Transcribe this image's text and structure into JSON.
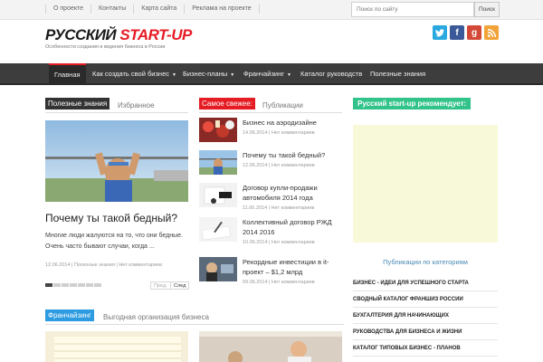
{
  "top_nav": {
    "items": [
      "О проекте",
      "Контакты",
      "Карта сайта",
      "Реклама на проекте"
    ]
  },
  "search": {
    "placeholder": "Поиск по сайту",
    "button_label": "Поиск"
  },
  "logo": {
    "part1": "РУССКИЙ ",
    "part2": "START-UP",
    "tagline": "Особенности создания и ведения бизнеса в России"
  },
  "social": {
    "twitter": "t",
    "facebook": "f",
    "google": "g",
    "rss": "rss"
  },
  "main_nav": {
    "items": [
      {
        "label": "Главная"
      },
      {
        "label": "Как создать свой бизнес"
      },
      {
        "label": "Бизнес-планы"
      },
      {
        "label": "Франчайзинг"
      },
      {
        "label": "Каталог руководств"
      },
      {
        "label": "Полезные знания"
      }
    ]
  },
  "featured": {
    "label": "Полезные знания",
    "sublabel": "Избранное",
    "title": "Почему ты такой бедный?",
    "text": "Многие люди жалуются на то, что они бедные. Очень часто бывают случаи, когда ...",
    "meta": "12.06.2014 | Полезные знания | Нет комментариев",
    "prev_label": "Пред.",
    "next_label": "След"
  },
  "publications": {
    "label": "Самое свежее:",
    "sublabel": "Публикации",
    "items": [
      {
        "title": "Бизнес на аэродизайне",
        "date": "14.06.2014 | Нет комментариев"
      },
      {
        "title": "Почему ты такой бедный?",
        "date": "12.06.2014 | Нет комментариев"
      },
      {
        "title": "Договор купли-продажи автомобиля 2014 года",
        "date": "11.06.2014 | Нет комментариев"
      },
      {
        "title": "Коллективный договор РЖД 2014 2016",
        "date": "10.06.2014 | Нет комментариев"
      },
      {
        "title": "Рекордные инвестиции в it-проект – $1,2 млрд",
        "date": "09.06.2014 | Нет комментариев"
      }
    ]
  },
  "recommend": {
    "label": "Русский start-up рекомендует:"
  },
  "categories": {
    "heading": "Публикации по категориям",
    "items": [
      "БИЗНЕС - ИДЕИ ДЛЯ УСПЕШНОГО СТАРТА",
      "СВОДНЫЙ КАТАЛОГ ФРАНШИЗ РОССИИ",
      "БУХГАЛТЕРИЯ ДЛЯ НАЧИНАЮЩИХ",
      "РУКОВОДСТВА ДЛЯ БИЗНЕСА И ЖИЗНИ",
      "КАТАЛОГ ТИПОВЫХ БИЗНЕС - ПЛАНОВ"
    ]
  },
  "franchising": {
    "label": "Франчайзинг",
    "sublabel": "Выгодная организация бизнеса"
  },
  "colors": {
    "accent_red": "#e61c24",
    "label_dark": "#333333",
    "label_green": "#32c38a",
    "label_blue": "#2c9be0",
    "nav_bg": "#3d3d3d",
    "twitter": "#2aa9e0",
    "facebook": "#3b5998",
    "google": "#d34836",
    "rss": "#f2a33a"
  }
}
